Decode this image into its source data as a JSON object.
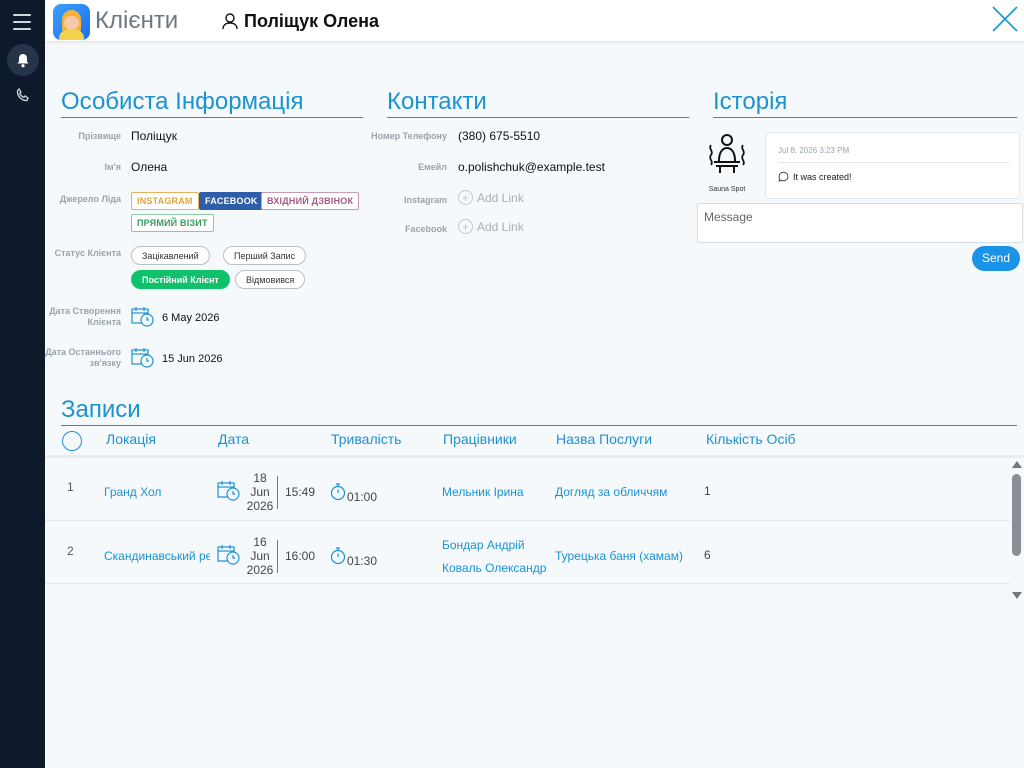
{
  "header": {
    "app_title": "Клієнти",
    "client_name": "Поліщук Олена"
  },
  "personal": {
    "title": "Особиста Інформація",
    "surname_label": "Прізвище",
    "surname": "Поліщук",
    "name_label": "Ім'я",
    "name": "Олена",
    "source_label": "Джерело Ліда",
    "sources": [
      "INSTAGRAM",
      "FACEBOOK",
      "ВХІДНИЙ ДЗВІНОК",
      "ПРЯМИЙ ВІЗИТ"
    ],
    "status_label": "Статус Клієнта",
    "statuses": [
      "Зацікавлений",
      "Перший Запис",
      "Постійний Клієнт",
      "Відмовився"
    ],
    "active_status": "Постійний Клієнт",
    "created_label_1": "Дата Створення",
    "created_label_2": "Клієнта",
    "created_date": "6 May 2026",
    "last_contact_label_1": "Дата Останнього",
    "last_contact_label_2": "зв'язку",
    "last_contact_date": "15 Jun 2026"
  },
  "contacts": {
    "title": "Контакти",
    "phone_label": "Номер Телефону",
    "phone": "(380) 675-5510",
    "email_label": "Емейл",
    "email": "o.polishchuk@example.test",
    "instagram_label": "Instagram",
    "facebook_label": "Facebook",
    "add_link": "Add Link"
  },
  "history": {
    "title": "Історія",
    "avatar_caption": "Sauna Spot",
    "entry_date": "Jul 8, 2026 3:23 PM",
    "entry_text": "It was created!",
    "message_placeholder": "Message",
    "send_label": "Send"
  },
  "records": {
    "title": "Записи",
    "columns": [
      "Локація",
      "Дата",
      "Тривалість",
      "Працівники",
      "Назва Послуги",
      "Кількість Осіб"
    ],
    "rows": [
      {
        "num": "1",
        "location": "Гранд Хол",
        "day": "18",
        "month": "Jun",
        "year": "2026",
        "time": "15:49",
        "duration": "01:00",
        "workers": [
          "Мельник Ірина"
        ],
        "service": "Догляд за обличчям",
        "persons": "1"
      },
      {
        "num": "2",
        "location": "Скандинавський ре",
        "day": "16",
        "month": "Jun",
        "year": "2026",
        "time": "16:00",
        "duration": "01:30",
        "workers": [
          "Бондар Андрій",
          "Коваль Олександр"
        ],
        "service": "Турецька баня (хамам)",
        "persons": "6"
      }
    ]
  },
  "colors": {
    "accent": "#1a93d1",
    "active_status": "#10c16b",
    "rail": "#0e1a2b"
  }
}
